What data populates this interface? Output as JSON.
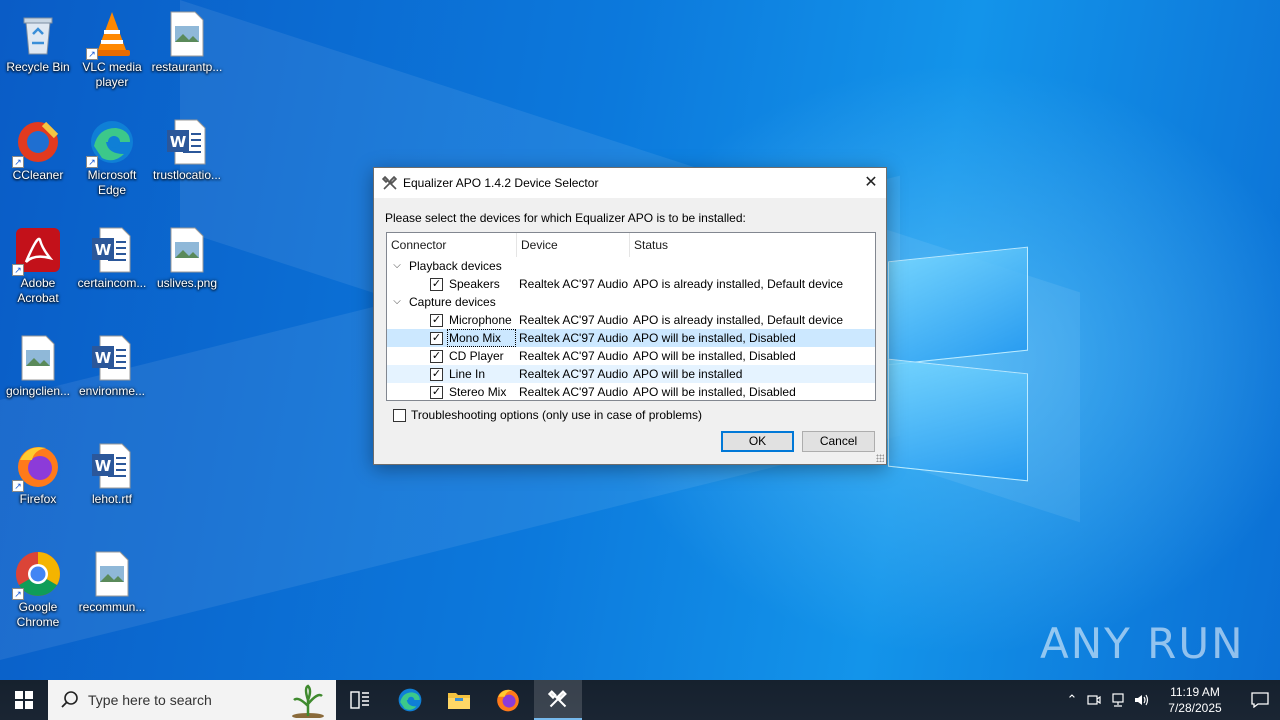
{
  "desktop": {
    "icons": [
      {
        "label": "Recycle Bin",
        "icon": "recycle-bin-icon"
      },
      {
        "label": "VLC media player",
        "icon": "vlc-icon"
      },
      {
        "label": "restaurantp...",
        "icon": "image-file-icon"
      },
      {
        "label": "CCleaner",
        "icon": "ccleaner-icon"
      },
      {
        "label": "Microsoft Edge",
        "icon": "edge-icon"
      },
      {
        "label": "trustlocatio...",
        "icon": "word-doc-icon"
      },
      {
        "label": "Adobe Acrobat",
        "icon": "acrobat-icon"
      },
      {
        "label": "certaincom...",
        "icon": "word-doc-icon"
      },
      {
        "label": "uslives.png",
        "icon": "image-file-icon"
      },
      {
        "label": "goingclien...",
        "icon": "image-file-icon"
      },
      {
        "label": "environme...",
        "icon": "word-doc-icon"
      },
      {
        "label": "Firefox",
        "icon": "firefox-icon"
      },
      {
        "label": "lehot.rtf",
        "icon": "word-doc-icon"
      },
      {
        "label": "Google Chrome",
        "icon": "chrome-icon"
      },
      {
        "label": "recommun...",
        "icon": "image-file-icon"
      }
    ]
  },
  "dialog": {
    "title": "Equalizer APO 1.4.2 Device Selector",
    "close_glyph": "✕",
    "instruction": "Please select the devices for which Equalizer APO is to be installed:",
    "columns": [
      "Connector",
      "Device",
      "Status"
    ],
    "groups": [
      {
        "label": "Playback devices",
        "rows": [
          {
            "connector": "Speakers",
            "device": "Realtek AC'97 Audio",
            "status": "APO is already installed, Default device",
            "checked": true
          }
        ]
      },
      {
        "label": "Capture devices",
        "rows": [
          {
            "connector": "Microphone",
            "device": "Realtek AC'97 Audio",
            "status": "APO is already installed, Default device",
            "checked": true
          },
          {
            "connector": "Mono Mix",
            "device": "Realtek AC'97 Audio",
            "status": "APO will be installed, Disabled",
            "checked": true
          },
          {
            "connector": "CD Player",
            "device": "Realtek AC'97 Audio",
            "status": "APO will be installed, Disabled",
            "checked": true
          },
          {
            "connector": "Line In",
            "device": "Realtek AC'97 Audio",
            "status": "APO will be installed",
            "checked": true
          },
          {
            "connector": "Stereo Mix",
            "device": "Realtek AC'97 Audio",
            "status": "APO will be installed, Disabled",
            "checked": true
          }
        ]
      }
    ],
    "troubleshooting_label": "Troubleshooting options (only use in case of problems)",
    "troubleshooting_checked": false,
    "ok_label": "OK",
    "cancel_label": "Cancel"
  },
  "watermark": "ANY RUN",
  "taskbar": {
    "search_placeholder": "Type here to search",
    "pinned": [
      "task-view-icon",
      "edge-icon",
      "file-explorer-icon",
      "firefox-icon",
      "equalizer-apo-icon"
    ],
    "time": "11:19 AM",
    "date": "7/28/2025"
  },
  "colors": {
    "selection": "#cce8ff",
    "hover": "#e5f3ff",
    "accent": "#0078d7"
  }
}
